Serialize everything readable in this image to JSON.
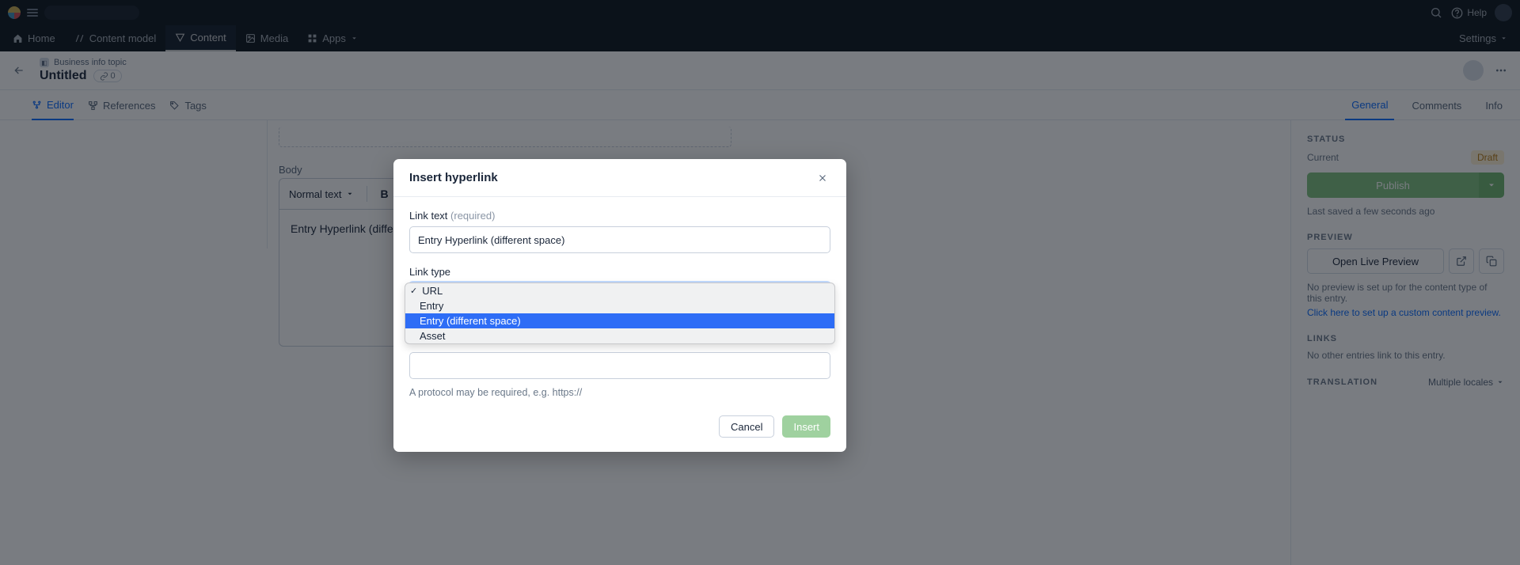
{
  "topbar": {
    "help_label": "Help"
  },
  "nav": {
    "home": "Home",
    "content_model": "Content model",
    "content": "Content",
    "media": "Media",
    "apps": "Apps",
    "settings": "Settings"
  },
  "header": {
    "crumb": "Business info topic",
    "title": "Untitled",
    "count": "0"
  },
  "left_tabs": {
    "editor": "Editor",
    "references": "References",
    "tags": "Tags"
  },
  "right_tabs": {
    "general": "General",
    "comments": "Comments",
    "info": "Info"
  },
  "editor": {
    "body_label": "Body",
    "normal": "Normal text",
    "body_text": "Entry Hyperlink (differ"
  },
  "sidebar": {
    "status_label": "STATUS",
    "current": "Current",
    "draft": "Draft",
    "publish": "Publish",
    "last_saved": "Last saved a few seconds ago",
    "preview_label": "PREVIEW",
    "open_preview": "Open Live Preview",
    "no_preview": "No preview is set up for the content type of this entry.",
    "preview_link": "Click here to set up a custom content preview.",
    "links_label": "LINKS",
    "no_links": "No other entries link to this entry.",
    "translation_label": "TRANSLATION",
    "multiple_locales": "Multiple locales"
  },
  "modal": {
    "title": "Insert hyperlink",
    "link_text_label": "Link text",
    "required": "(required)",
    "link_text_value": "Entry Hyperlink (different space)",
    "link_type_label": "Link type",
    "options": {
      "url": "URL",
      "entry": "Entry",
      "entry_diff": "Entry (different space)",
      "asset": "Asset"
    },
    "hint": "A protocol may be required, e.g. https://",
    "cancel": "Cancel",
    "insert": "Insert"
  }
}
